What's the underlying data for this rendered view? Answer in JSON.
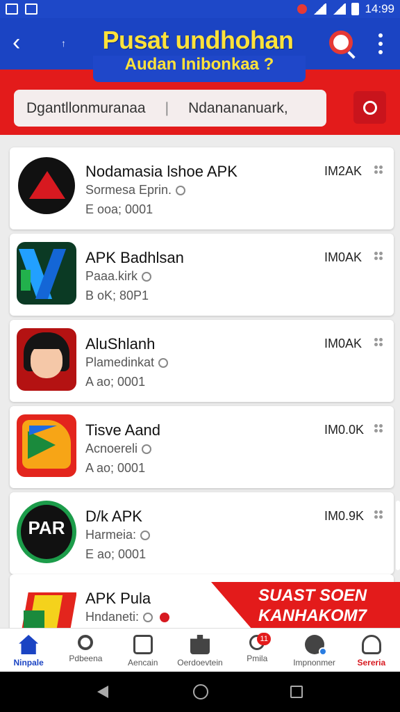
{
  "status_bar": {
    "time": "14:99"
  },
  "header": {
    "title": "Pusat undhohan",
    "subtitle": "Audan Inibonkaa ?",
    "back_icon": "‹",
    "small_icon": "↑"
  },
  "search": {
    "left_text": "Dgantllonmuranaa",
    "separator": "|",
    "right_text": "Ndanananuark,"
  },
  "apps": [
    {
      "name": "Nodamasia lshoe APK",
      "sub": "Sormesa Eprin.",
      "meta": "E ooa; 0001",
      "size": "IM2AK"
    },
    {
      "name": "APK Badhlsan",
      "sub": "Paaa.kirk",
      "meta": "B oK; 80P1",
      "size": "IM0AK"
    },
    {
      "name": "AluShlanh",
      "sub": "Plamedinkat",
      "meta": "A ao; 0001",
      "size": "IM0AK"
    },
    {
      "name": "Tisve Aand",
      "sub": "Acnoereli",
      "meta": "A ao; 0001",
      "size": "IM0.0K"
    },
    {
      "name": "D/k APK",
      "sub": "Harmeia:",
      "meta": "E ao; 0001",
      "size": "IM0.9K"
    },
    {
      "name": "APK Pula",
      "sub": "Hndaneti:",
      "meta": "",
      "size": ""
    }
  ],
  "logos": {
    "logo5_text": "PAR"
  },
  "promo": {
    "line1": "SUAST SOEN",
    "line2": "KANHAKOM7"
  },
  "bottom_nav": [
    {
      "label": "Ninpale",
      "icon": "home-icon"
    },
    {
      "label": "Pdbeena",
      "icon": "search-icon"
    },
    {
      "label": "Aencain",
      "icon": "box-icon"
    },
    {
      "label": "Oerdoevtein",
      "icon": "puzzle-icon"
    },
    {
      "label": "Pmila",
      "icon": "people-icon",
      "badge": "11"
    },
    {
      "label": "Impnonmer",
      "icon": "ball-icon"
    },
    {
      "label": "Sereria",
      "icon": "user-icon"
    }
  ],
  "colors": {
    "primary": "#1b44c3",
    "accent": "#e31b1b",
    "title": "#ffe23a"
  }
}
